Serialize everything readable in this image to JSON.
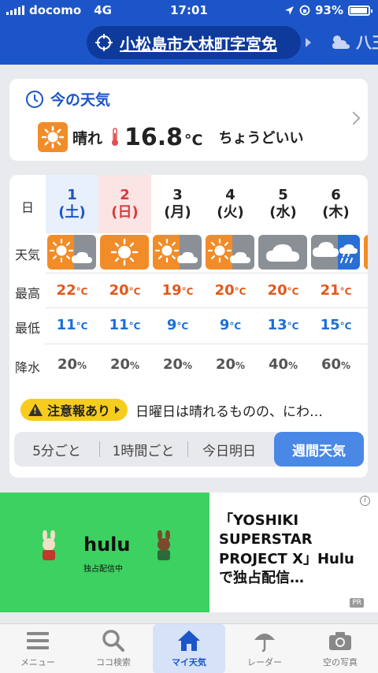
{
  "status": {
    "carrier": "docomo",
    "network": "4G",
    "time": "17:01",
    "battery": "93%"
  },
  "header": {
    "location": "小松島市大林町字宮免",
    "next_location": "八王"
  },
  "current": {
    "title": "今の天気",
    "condition": "晴れ",
    "temperature": "16.8",
    "unit": "°C",
    "comment": "ちょうどいい"
  },
  "weekly": {
    "row_labels": {
      "day": "日",
      "weather": "天気",
      "high": "最高",
      "low": "最低",
      "rain": "降水"
    },
    "days": [
      {
        "date": "1",
        "weekday": "(土)",
        "icon": "sun-cloud-icon",
        "high": "22",
        "low": "11",
        "rain": "20"
      },
      {
        "date": "2",
        "weekday": "(日)",
        "icon": "sun-icon",
        "high": "20",
        "low": "11",
        "rain": "20"
      },
      {
        "date": "3",
        "weekday": "(月)",
        "icon": "sun-cloud-icon",
        "high": "19",
        "low": "9",
        "rain": "20"
      },
      {
        "date": "4",
        "weekday": "(火)",
        "icon": "sun-cloud-icon",
        "high": "20",
        "low": "9",
        "rain": "20"
      },
      {
        "date": "5",
        "weekday": "(水)",
        "icon": "cloud-icon",
        "high": "20",
        "low": "13",
        "rain": "40"
      },
      {
        "date": "6",
        "weekday": "(木)",
        "icon": "cloud-rain-icon",
        "high": "21",
        "low": "15",
        "rain": "60"
      }
    ],
    "temp_unit": "°C",
    "rain_unit": "%",
    "notice_label": "注意報あり",
    "notice_text": "日曜日は晴れるものの、にわ…"
  },
  "segments": {
    "items": [
      "5分ごと",
      "1時間ごと",
      "今日明日",
      "週間天気"
    ],
    "active": "週間天気"
  },
  "ad": {
    "brand": "hulu",
    "brand_sub": "独占配信中",
    "text": "「YOSHIKI SUPERSTAR PROJECT X」Hulu で独占配信…",
    "info": "i",
    "pr": "PR"
  },
  "tabs": [
    {
      "label": "メニュー",
      "icon": "menu-icon"
    },
    {
      "label": "ココ検索",
      "icon": "search-icon"
    },
    {
      "label": "マイ天気",
      "icon": "home-icon"
    },
    {
      "label": "レーダー",
      "icon": "umbrella-icon"
    },
    {
      "label": "空の写真",
      "icon": "camera-icon"
    }
  ],
  "colors": {
    "header_blue": "#1c55c7",
    "sun_orange": "#f28c28",
    "high_orange": "#e0591d",
    "low_blue": "#1c6fd6",
    "warning_yellow": "#f6cc1e",
    "ad_green": "#3cd160"
  }
}
